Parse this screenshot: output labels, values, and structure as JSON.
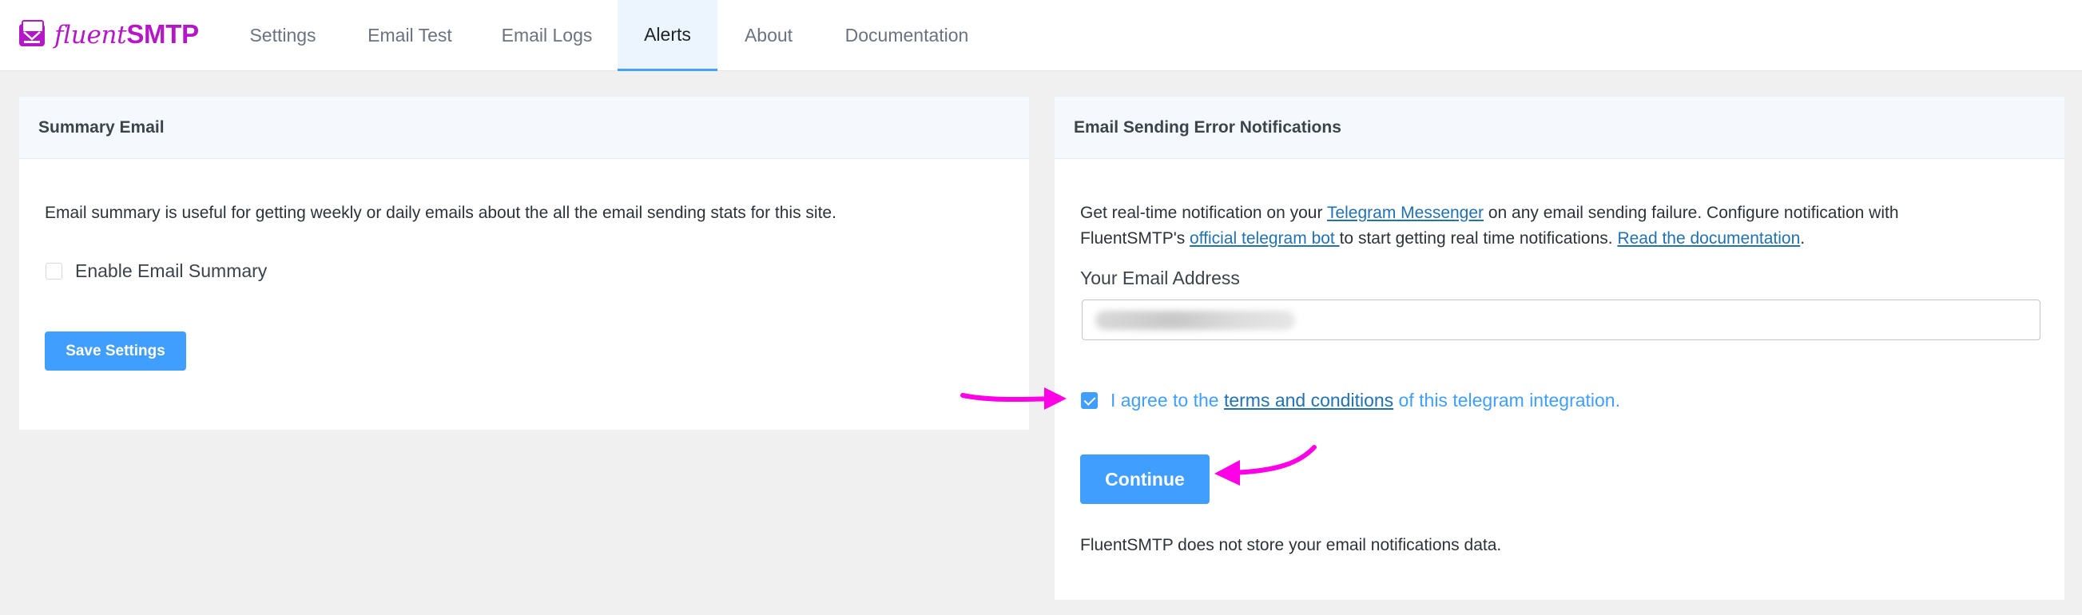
{
  "app": {
    "logo_text_1": "fluent",
    "logo_text_2": "SMTP",
    "brand_color": "#b418c6",
    "accent_color": "#409eff"
  },
  "nav": {
    "tabs": [
      {
        "label": "Settings"
      },
      {
        "label": "Email Test"
      },
      {
        "label": "Email Logs"
      },
      {
        "label": "Alerts",
        "active": true
      },
      {
        "label": "About"
      },
      {
        "label": "Documentation"
      }
    ]
  },
  "summary": {
    "title": "Summary Email",
    "description": "Email summary is useful for getting weekly or daily emails about the all the email sending stats for this site.",
    "checkbox_label": "Enable Email Summary",
    "checkbox_checked": false,
    "save_label": "Save Settings"
  },
  "errors": {
    "title": "Email Sending Error Notifications",
    "desc_part1": "Get real-time notification on your ",
    "telegram_link": "Telegram Messenger",
    "desc_part2": " on any email sending failure. Configure notification with",
    "desc_part3": "FluentSMTP's ",
    "bot_link": "official telegram bot ",
    "desc_part4": "to start getting real time notifications. ",
    "docs_link": "Read the documentation",
    "desc_part5": ".",
    "email_label": "Your Email Address",
    "email_value": "",
    "agree_part1": "I agree to the ",
    "terms_link": "terms and conditions",
    "agree_part2": " of this telegram integration.",
    "agree_checked": true,
    "continue_label": "Continue",
    "footer_note": "FluentSMTP does not store your email notifications data."
  },
  "annotation_color": "#ff00e6"
}
